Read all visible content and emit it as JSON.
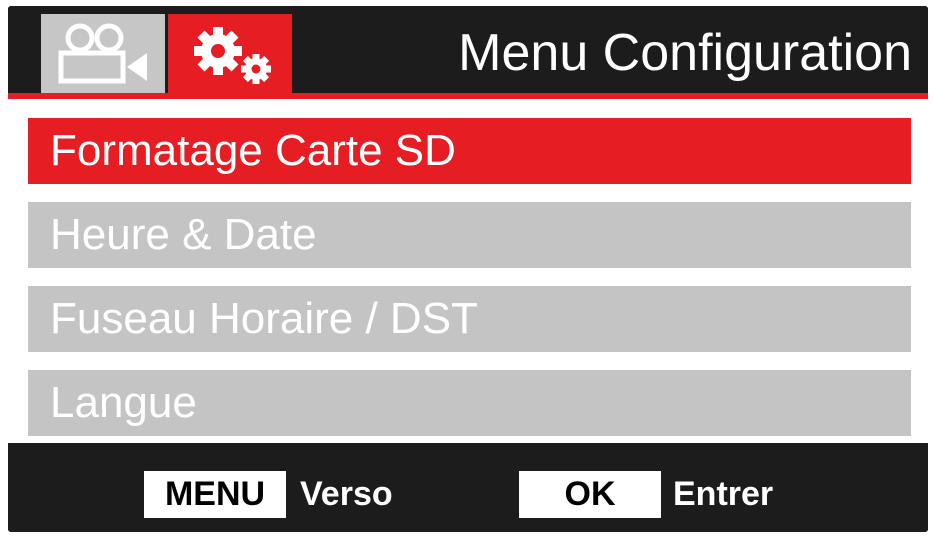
{
  "header": {
    "title": "Menu Configuration",
    "tabs": [
      {
        "icon": "video-camera-icon",
        "active": false
      },
      {
        "icon": "gears-icon",
        "active": true
      }
    ]
  },
  "menu": {
    "items": [
      {
        "label": "Formatage Carte SD",
        "selected": true
      },
      {
        "label": "Heure & Date",
        "selected": false
      },
      {
        "label": "Fuseau Horaire / DST",
        "selected": false
      },
      {
        "label": "Langue",
        "selected": false
      }
    ]
  },
  "footer": {
    "menu_key": "MENU",
    "menu_action": "Verso",
    "ok_key": "OK",
    "ok_action": "Entrer"
  },
  "colors": {
    "accent": "#e71d24",
    "inactive": "#c4c4c4",
    "background": "#1c1c1c"
  }
}
